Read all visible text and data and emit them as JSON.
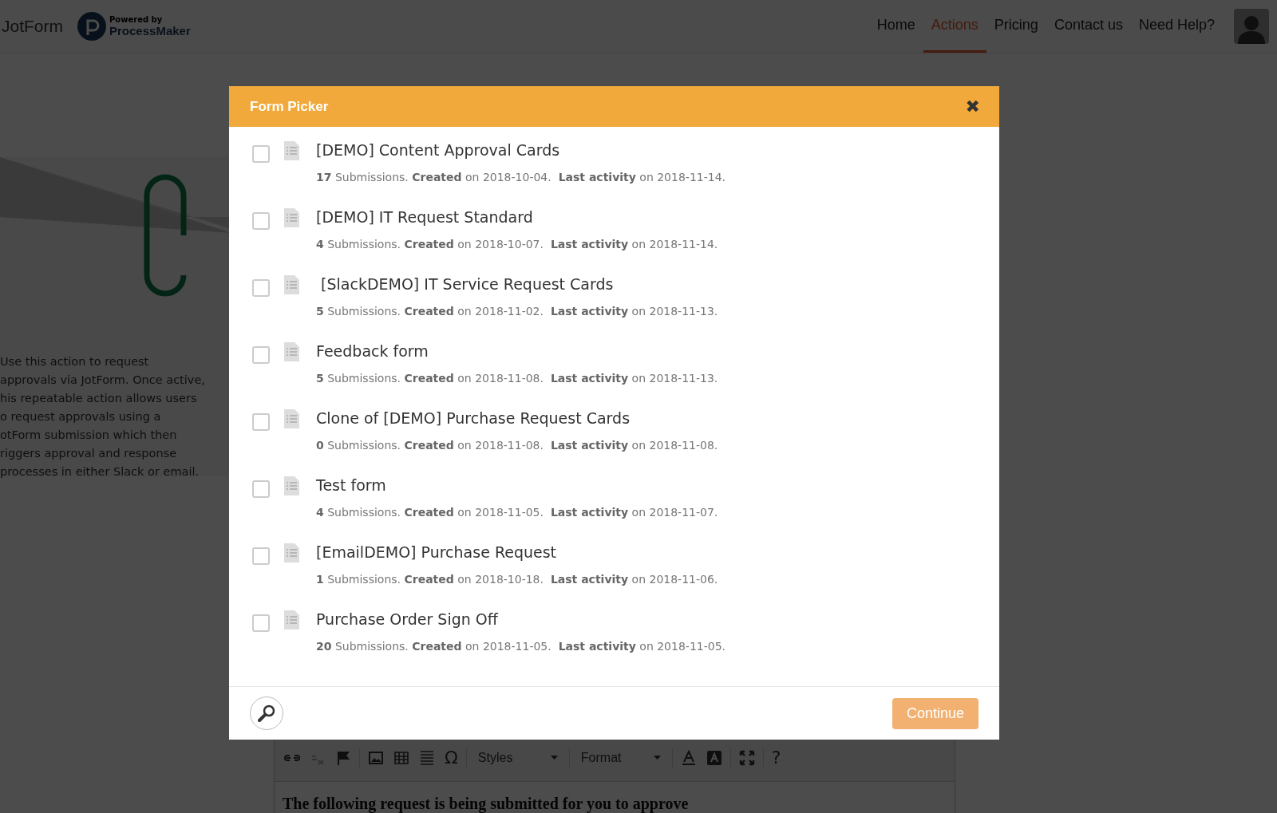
{
  "header": {
    "brand": "JotForm",
    "partner_small": "Powered by",
    "partner": "ProcessMaker",
    "nav": [
      {
        "label": "Home",
        "selected": false
      },
      {
        "label": "Actions",
        "selected": true
      },
      {
        "label": "Pricing",
        "selected": false
      },
      {
        "label": "Contact us",
        "selected": false
      },
      {
        "label": "Need Help?",
        "selected": false
      }
    ]
  },
  "description_lines": [
    "Use this action to request",
    "approvals via JotForm. Once active,",
    "his repeatable action allows users",
    "o request approvals using a",
    "otForm submission which then",
    "riggers approval and response",
    "processes in either Slack or email."
  ],
  "editor": {
    "toolbar": [
      {
        "kind": "icon",
        "disabled": false
      },
      {
        "kind": "icon",
        "disabled": true
      },
      {
        "kind": "icon",
        "disabled": false
      },
      {
        "kind": "sep"
      },
      {
        "kind": "icon",
        "disabled": false
      },
      {
        "kind": "icon",
        "disabled": false
      },
      {
        "kind": "icon",
        "disabled": false
      },
      {
        "kind": "text",
        "label": "Ω"
      },
      {
        "kind": "sep"
      },
      {
        "kind": "dropdown",
        "label": "Styles"
      },
      {
        "kind": "sep"
      },
      {
        "kind": "dropdown",
        "label": "Format"
      },
      {
        "kind": "sep"
      },
      {
        "kind": "icon",
        "disabled": false
      },
      {
        "kind": "icon",
        "disabled": false
      },
      {
        "kind": "sep"
      },
      {
        "kind": "icon",
        "disabled": false
      },
      {
        "kind": "sep"
      },
      {
        "kind": "text",
        "label": "?"
      }
    ],
    "content": "The following request is being submitted for you to approve"
  },
  "modal": {
    "title": "Form Picker",
    "close": "✖",
    "forms": [
      {
        "name": "[DEMO] Content Approval Cards",
        "meta": "**17** Submissions. **Created** on 2018-10-04.  **Last activity** on 2018-11-14.",
        "checked": false
      },
      {
        "name": "[DEMO] IT Request Standard",
        "meta": "**4** Submissions. **Created** on 2018-10-07.  **Last activity** on 2018-11-14.",
        "checked": false
      },
      {
        "name": " [SlackDEMO] IT Service Request Cards",
        "meta": "**5** Submissions. **Created** on 2018-11-02.  **Last activity** on 2018-11-13.",
        "checked": false
      },
      {
        "name": "Feedback form",
        "meta": "**5** Submissions. **Created** on 2018-11-08.  **Last activity** on 2018-11-13.",
        "checked": false
      },
      {
        "name": "Clone of [DEMO] Purchase Request Cards",
        "meta": "**0** Submissions. **Created** on 2018-11-08.  **Last activity** on 2018-11-08.",
        "checked": false
      },
      {
        "name": "Test form",
        "meta": "**4** Submissions. **Created** on 2018-11-05.  **Last activity** on 2018-11-07.",
        "checked": false
      },
      {
        "name": "[EmailDEMO] Purchase Request",
        "meta": "**1** Submissions. **Created** on 2018-10-18.  **Last activity** on 2018-11-06.",
        "checked": false
      },
      {
        "name": "Purchase Order Sign Off",
        "meta": "**20** Submissions. **Created** on 2018-11-05.  **Last activity** on 2018-11-05.",
        "checked": false
      }
    ],
    "continue": "Continue"
  }
}
